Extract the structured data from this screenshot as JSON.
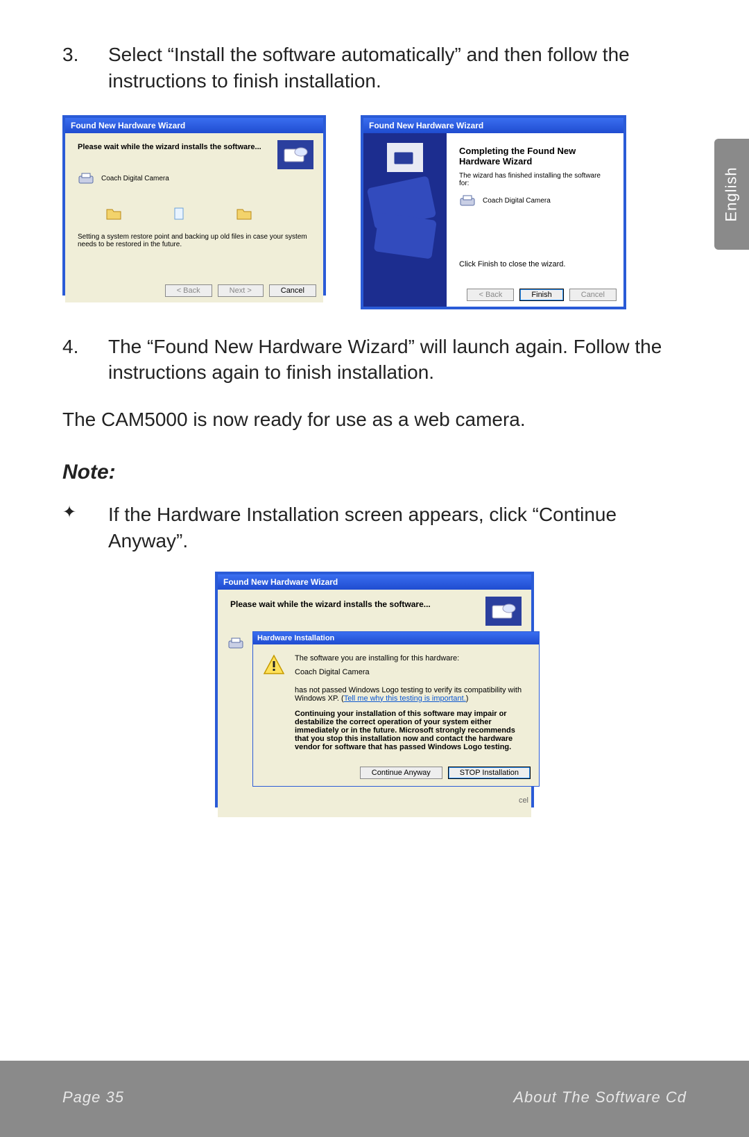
{
  "steps": {
    "s3": {
      "num": "3.",
      "text": "Select “Install the software automatically” and then follow the instructions to finish installation."
    },
    "s4": {
      "num": "4.",
      "text": "The “Found New Hardware Wizard” will launch again. Follow the instructions again to finish installation."
    }
  },
  "ready_line": "The CAM5000 is now ready for use as a web camera.",
  "note_heading": "Note:",
  "note_bullet": {
    "star": "✦",
    "text": "If the Hardware Installation screen appears, click “Continue Anyway”."
  },
  "dialog1": {
    "title": "Found New Hardware Wizard",
    "header_msg": "Please wait while the wizard installs the software...",
    "device": "Coach Digital Camera",
    "restore_msg": "Setting a system restore point and backing up old files in case your system needs to be restored in the future.",
    "back": "< Back",
    "next": "Next >",
    "cancel": "Cancel"
  },
  "dialog2": {
    "title": "Found New Hardware Wizard",
    "heading": "Completing the Found New Hardware Wizard",
    "done_line": "The wizard has finished installing the software for:",
    "device": "Coach Digital Camera",
    "close_line": "Click Finish to close the wizard.",
    "back": "< Back",
    "finish": "Finish",
    "cancel": "Cancel"
  },
  "dialog3": {
    "outer_title": "Found New Hardware Wizard",
    "outer_msg": "Please wait while the wizard installs the software...",
    "sub_title": "Hardware Installation",
    "warn_intro": "The software you are installing for this hardware:",
    "device": "Coach Digital Camera",
    "logo_line_a": "has not passed Windows Logo testing to verify its compatibility with Windows XP. (",
    "logo_link": "Tell me why this testing is important.",
    "logo_line_b": ")",
    "bold_warn": "Continuing your installation of this software may impair or destabilize the correct operation of your system either immediately or in the future. Microsoft strongly recommends that you stop this installation now and contact the hardware vendor for software that has passed Windows Logo testing.",
    "continue": "Continue Anyway",
    "stop": "STOP Installation",
    "bg_cancel": "cel"
  },
  "lang_tab": "English",
  "footer": {
    "page": "Page 35",
    "section": "About The Software Cd"
  }
}
